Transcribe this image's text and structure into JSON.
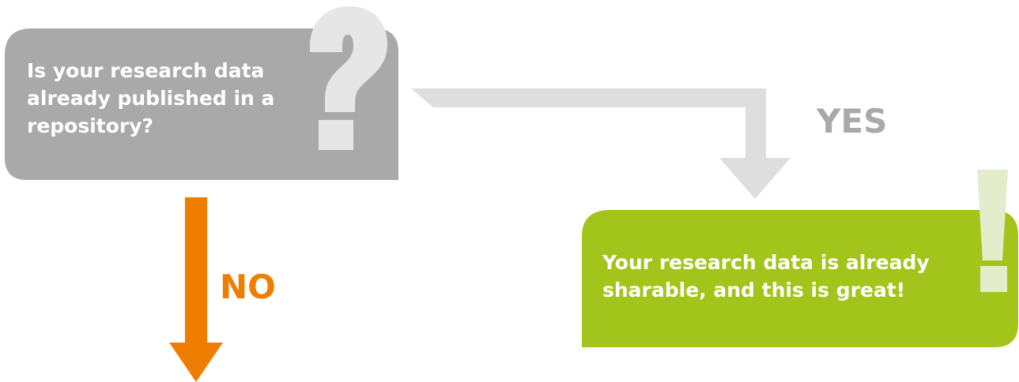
{
  "question": {
    "lines": [
      "Is your research data",
      "already published in a",
      "repository?"
    ],
    "mark": "?"
  },
  "answer": {
    "lines": [
      "Your research data is already",
      "sharable, and this is great!"
    ],
    "mark": "!"
  },
  "branches": {
    "yes_label": "YES",
    "no_label": "NO"
  },
  "colors": {
    "question_box": "#a9a9a9",
    "question_mark": "#e6e6e6",
    "answer_box": "#a3c41a",
    "answer_mark": "#e3eccb",
    "yes_arrow": "#dedede",
    "yes_text": "#a9a9a9",
    "no_arrow": "#ef7d00",
    "no_text": "#ef7d00"
  }
}
